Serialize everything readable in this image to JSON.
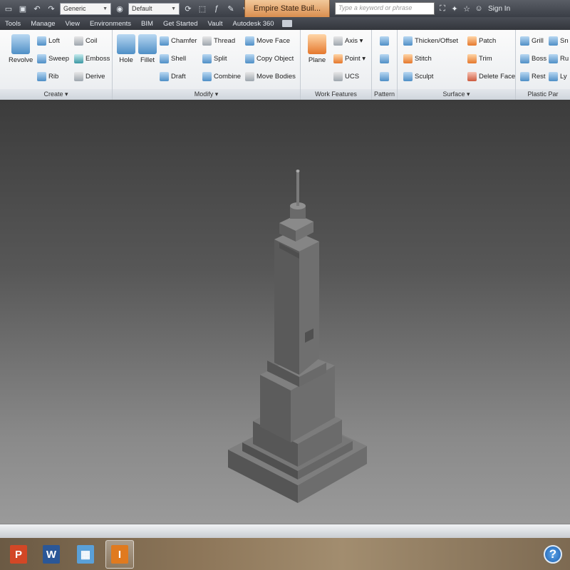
{
  "titlebar": {
    "style_combo": "Generic",
    "appearance_combo": "Default",
    "document_tab": "Empire State Buil...",
    "search_placeholder": "Type a keyword or phrase",
    "sign_in": "Sign In"
  },
  "menu": {
    "tabs": [
      "Tools",
      "Manage",
      "View",
      "Environments",
      "BIM",
      "Get Started",
      "Vault",
      "Autodesk 360"
    ]
  },
  "ribbon": {
    "create": {
      "revolve": "Revolve",
      "loft": "Loft",
      "coil": "Coil",
      "sweep": "Sweep",
      "emboss": "Emboss",
      "rib": "Rib",
      "derive": "Derive",
      "footer": "Create ▾"
    },
    "modify": {
      "hole": "Hole",
      "fillet": "Fillet",
      "chamfer": "Chamfer",
      "thread": "Thread",
      "move_face": "Move Face",
      "shell": "Shell",
      "split": "Split",
      "copy_object": "Copy Object",
      "draft": "Draft",
      "combine": "Combine",
      "move_bodies": "Move Bodies",
      "footer": "Modify ▾"
    },
    "work_features": {
      "plane": "Plane",
      "axis": "Axis ▾",
      "point": "Point ▾",
      "ucs": "UCS",
      "footer": "Work Features"
    },
    "pattern": {
      "footer": "Pattern"
    },
    "surface": {
      "thicken": "Thicken/Offset",
      "patch": "Patch",
      "stitch": "Stitch",
      "trim": "Trim",
      "sculpt": "Sculpt",
      "delete_face": "Delete Face",
      "footer": "Surface ▾"
    },
    "plastic_part": {
      "grill": "Grill",
      "boss": "Boss",
      "rest": "Rest",
      "sn": "Sn",
      "ru": "Ru",
      "ly": "Ly",
      "footer": "Plastic Par"
    }
  },
  "taskbar": {
    "apps": [
      {
        "name": "PowerPoint",
        "glyph": "P",
        "color": "#d24726"
      },
      {
        "name": "Word",
        "glyph": "W",
        "color": "#2b5797"
      },
      {
        "name": "Explorer",
        "glyph": "▦",
        "color": "#5aa0d8"
      },
      {
        "name": "Inventor",
        "glyph": "I",
        "color": "#e07a1f"
      }
    ],
    "help_glyph": "?"
  }
}
